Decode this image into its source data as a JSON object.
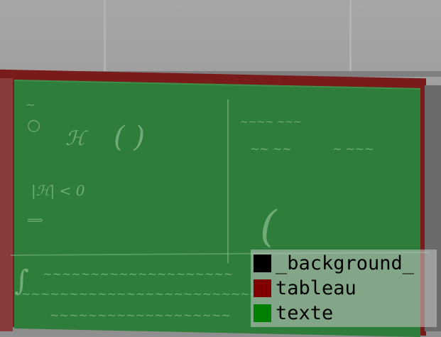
{
  "legend": {
    "items": [
      {
        "label": "_background_",
        "color": "#000000"
      },
      {
        "label": "tableau",
        "color": "#800000"
      },
      {
        "label": "texte",
        "color": "#008000"
      }
    ]
  }
}
